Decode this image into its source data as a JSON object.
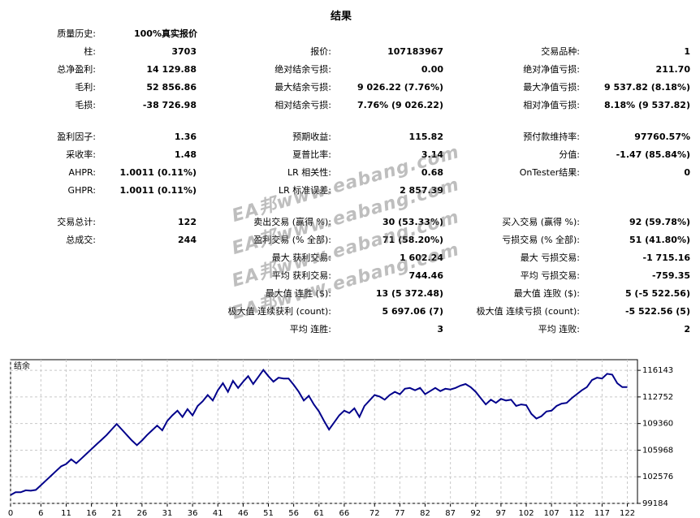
{
  "title": "结果",
  "top": {
    "label": "质量历史:",
    "value": "100%真实报价"
  },
  "stats": [
    [
      {
        "l": "柱:",
        "v": "3703"
      },
      {
        "l": "报价:",
        "v": "107183967"
      },
      {
        "l": "交易品种:",
        "v": "1"
      }
    ],
    [
      {
        "l": "总净盈利:",
        "v": "14 129.88"
      },
      {
        "l": "绝对结余亏损:",
        "v": "0.00"
      },
      {
        "l": "绝对净值亏损:",
        "v": "211.70"
      }
    ],
    [
      {
        "l": "毛利:",
        "v": "52 856.86"
      },
      {
        "l": "最大结余亏损:",
        "v": "9 026.22 (7.76%)"
      },
      {
        "l": "最大净值亏损:",
        "v": "9 537.82 (8.18%)"
      }
    ],
    [
      {
        "l": "毛损:",
        "v": "-38 726.98"
      },
      {
        "l": "相对结余亏损:",
        "v": "7.76% (9 026.22)"
      },
      {
        "l": "相对净值亏损:",
        "v": "8.18% (9 537.82)"
      }
    ],
    [
      {
        "l": "盈利因子:",
        "v": "1.36"
      },
      {
        "l": "预期收益:",
        "v": "115.82"
      },
      {
        "l": "预付款维持率:",
        "v": "97760.57%"
      }
    ],
    [
      {
        "l": "采收率:",
        "v": "1.48"
      },
      {
        "l": "夏普比率:",
        "v": "3.14"
      },
      {
        "l": "分值:",
        "v": "-1.47 (85.84%)"
      }
    ],
    [
      {
        "l": "AHPR:",
        "v": "1.0011 (0.11%)"
      },
      {
        "l": "LR 相关性:",
        "v": "0.68"
      },
      {
        "l": "OnTester结果:",
        "v": "0"
      }
    ],
    [
      {
        "l": "GHPR:",
        "v": "1.0011 (0.11%)"
      },
      {
        "l": "LR 标准误差:",
        "v": "2 857.39"
      },
      null
    ],
    [
      {
        "l": "交易总计:",
        "v": "122"
      },
      {
        "l": "卖出交易 (赢得 %):",
        "v": "30 (53.33%)"
      },
      {
        "l": "买入交易 (赢得 %):",
        "v": "92 (59.78%)"
      }
    ],
    [
      {
        "l": "总成交:",
        "v": "244"
      },
      {
        "l": "盈利交易 (% 全部):",
        "v": "71 (58.20%)"
      },
      {
        "l": "亏损交易 (% 全部):",
        "v": "51 (41.80%)"
      }
    ],
    [
      null,
      {
        "l": "最大 获利交易:",
        "v": "1 602.24"
      },
      {
        "l": "最大 亏损交易:",
        "v": "-1 715.16"
      }
    ],
    [
      null,
      {
        "l": "平均 获利交易:",
        "v": "744.46"
      },
      {
        "l": "平均 亏损交易:",
        "v": "-759.35"
      }
    ],
    [
      null,
      {
        "l": "最大值 连胜 ($):",
        "v": "13 (5 372.48)"
      },
      {
        "l": "最大值 连败 ($):",
        "v": "5 (-5 522.56)"
      }
    ],
    [
      null,
      {
        "l": "极大值 连续获利 (count):",
        "v": "5 697.06 (7)"
      },
      {
        "l": "极大值 连续亏损 (count):",
        "v": "-5 522.56 (5)"
      }
    ],
    [
      null,
      {
        "l": "平均 连胜:",
        "v": "3"
      },
      {
        "l": "平均 连败:",
        "v": "2"
      }
    ]
  ],
  "watermark": [
    "EA邦www.eabang.com",
    "EA邦www.eabang.com",
    "EA邦www.eabang.com",
    "EA邦www.eabang.com"
  ],
  "chart_data": {
    "type": "line",
    "title": "结余",
    "x_ticks": [
      "0",
      "6",
      "11",
      "16",
      "21",
      "26",
      "31",
      "36",
      "41",
      "46",
      "51",
      "56",
      "61",
      "66",
      "72",
      "77",
      "82",
      "87",
      "92",
      "97",
      "102",
      "107",
      "112",
      "117",
      "122"
    ],
    "y_ticks": [
      "116143",
      "112752",
      "109360",
      "105968",
      "102576",
      "99184"
    ],
    "xlim": [
      0,
      124
    ],
    "ylim": [
      99184,
      117500
    ],
    "grid": true,
    "color": "#00008b",
    "x": [
      0,
      1,
      2,
      3,
      4,
      5,
      6,
      7,
      8,
      9,
      10,
      11,
      12,
      13,
      14,
      15,
      16,
      17,
      18,
      19,
      20,
      21,
      22,
      23,
      24,
      25,
      26,
      27,
      28,
      29,
      30,
      31,
      32,
      33,
      34,
      35,
      36,
      37,
      38,
      39,
      40,
      41,
      42,
      43,
      44,
      45,
      46,
      47,
      48,
      49,
      50,
      51,
      52,
      53,
      54,
      55,
      56,
      57,
      58,
      59,
      60,
      61,
      62,
      63,
      64,
      65,
      66,
      67,
      68,
      69,
      70,
      71,
      72,
      73,
      74,
      75,
      76,
      77,
      78,
      79,
      80,
      81,
      82,
      83,
      84,
      85,
      86,
      87,
      88,
      89,
      90,
      91,
      92,
      93,
      94,
      95,
      96,
      97,
      98,
      99,
      100,
      101,
      102,
      103,
      104,
      105,
      106,
      107,
      108,
      109,
      110,
      111,
      112,
      113,
      114,
      115,
      116,
      117,
      118,
      119,
      120,
      121,
      122
    ],
    "values": [
      100250,
      100600,
      100600,
      100850,
      100800,
      100900,
      101500,
      102100,
      102700,
      103300,
      103900,
      104200,
      104800,
      104300,
      104900,
      105500,
      106100,
      106700,
      107300,
      107900,
      108600,
      109300,
      108600,
      107900,
      107200,
      106600,
      107200,
      107900,
      108500,
      109100,
      108500,
      109700,
      110400,
      111000,
      110200,
      111200,
      110400,
      111600,
      112200,
      113000,
      112300,
      113600,
      114500,
      113400,
      114800,
      113900,
      114700,
      115400,
      114400,
      115300,
      116200,
      115400,
      114700,
      115200,
      115100,
      115100,
      114300,
      113400,
      112300,
      112900,
      111800,
      110900,
      109700,
      108600,
      109500,
      110400,
      111000,
      110700,
      111300,
      110200,
      111600,
      112300,
      113000,
      112800,
      112400,
      113000,
      113400,
      113100,
      113800,
      113900,
      113600,
      113900,
      113100,
      113500,
      113900,
      113500,
      113800,
      113700,
      113900,
      114200,
      114400,
      114000,
      113400,
      112600,
      111800,
      112400,
      112000,
      112500,
      112300,
      112400,
      111600,
      111800,
      111700,
      110600,
      110000,
      110300,
      110900,
      111000,
      111600,
      111900,
      112000,
      112600,
      113100,
      113600,
      114000,
      114900,
      115200,
      115100,
      115700,
      115600,
      114500,
      114000,
      114000
    ]
  }
}
